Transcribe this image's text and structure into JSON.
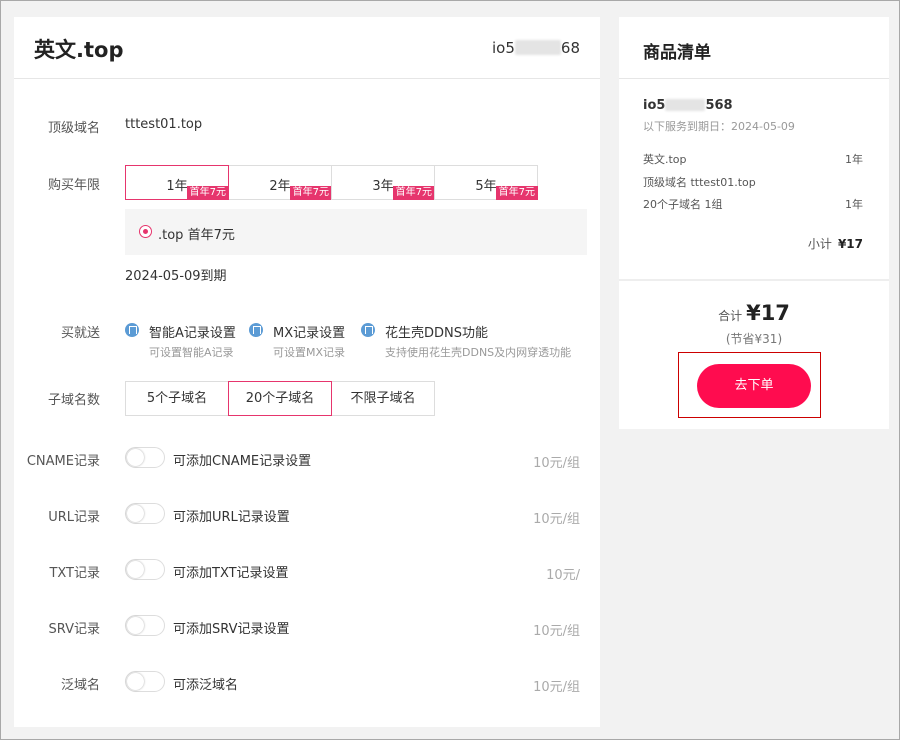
{
  "main": {
    "title": "英文.top",
    "user_prefix": "io5",
    "user_suffix": "68",
    "rows": {
      "top_domain_label": "顶级域名",
      "top_domain_value": "tttest01.top",
      "purchase_period_label": "购买年限",
      "gift_label": "买就送",
      "subdomain_count_label": "子域名数"
    },
    "years": [
      {
        "label": "1年",
        "badge": "首年7元",
        "selected": true
      },
      {
        "label": "2年",
        "badge": "首年7元",
        "selected": false
      },
      {
        "label": "3年",
        "badge": "首年7元",
        "selected": false
      },
      {
        "label": "5年",
        "badge": "首年7元",
        "selected": false
      }
    ],
    "price_option": ".top 首年7元",
    "expiry": "2024-05-09到期",
    "gifts": [
      {
        "title": "智能A记录设置",
        "desc": "可设置智能A记录"
      },
      {
        "title": "MX记录设置",
        "desc": "可设置MX记录"
      },
      {
        "title": "花生壳DDNS功能",
        "desc": "支持使用花生壳DDNS及内网穿透功能"
      }
    ],
    "subdomain_options": [
      {
        "label": "5个子域名",
        "selected": false
      },
      {
        "label": "20个子域名",
        "selected": true
      },
      {
        "label": "不限子域名",
        "selected": false
      }
    ],
    "addons": [
      {
        "label": "CNAME记录",
        "toggle_text": "可添加CNAME记录设置",
        "unit": "10元/组",
        "enabled": false
      },
      {
        "label": "URL记录",
        "toggle_text": "可添加URL记录设置",
        "unit": "10元/组",
        "enabled": false
      },
      {
        "label": "TXT记录",
        "toggle_text": "可添加TXT记录设置",
        "unit": "10元/",
        "enabled": false
      },
      {
        "label": "SRV记录",
        "toggle_text": "可添加SRV记录设置",
        "unit": "10元/组",
        "enabled": false
      },
      {
        "label": "泛域名",
        "toggle_text": "可添泛域名",
        "unit": "10元/组",
        "enabled": false
      }
    ]
  },
  "side": {
    "title": "商品清单",
    "user_prefix": "io5",
    "user_suffix": "568",
    "expiry_note": "以下服务到期日：2024-05-09",
    "items": [
      {
        "name": "英文.top",
        "qty": "1年"
      },
      {
        "name": "顶级域名 tttest01.top",
        "qty": ""
      },
      {
        "name": "20个子域名 1组",
        "qty": "1年"
      }
    ],
    "subtotal_label": "小计",
    "subtotal_value": "¥17",
    "total_label": "合计",
    "total_value": "¥17",
    "saved_text": "(节省¥31)",
    "order_button": "去下单"
  },
  "colors": {
    "accent": "#e6356d",
    "order_button": "#ff0c4f",
    "gift_icon": "#5b9bd5"
  },
  "icons": {
    "gift": "bookmark-icon",
    "radio": "radio-selected-icon"
  }
}
